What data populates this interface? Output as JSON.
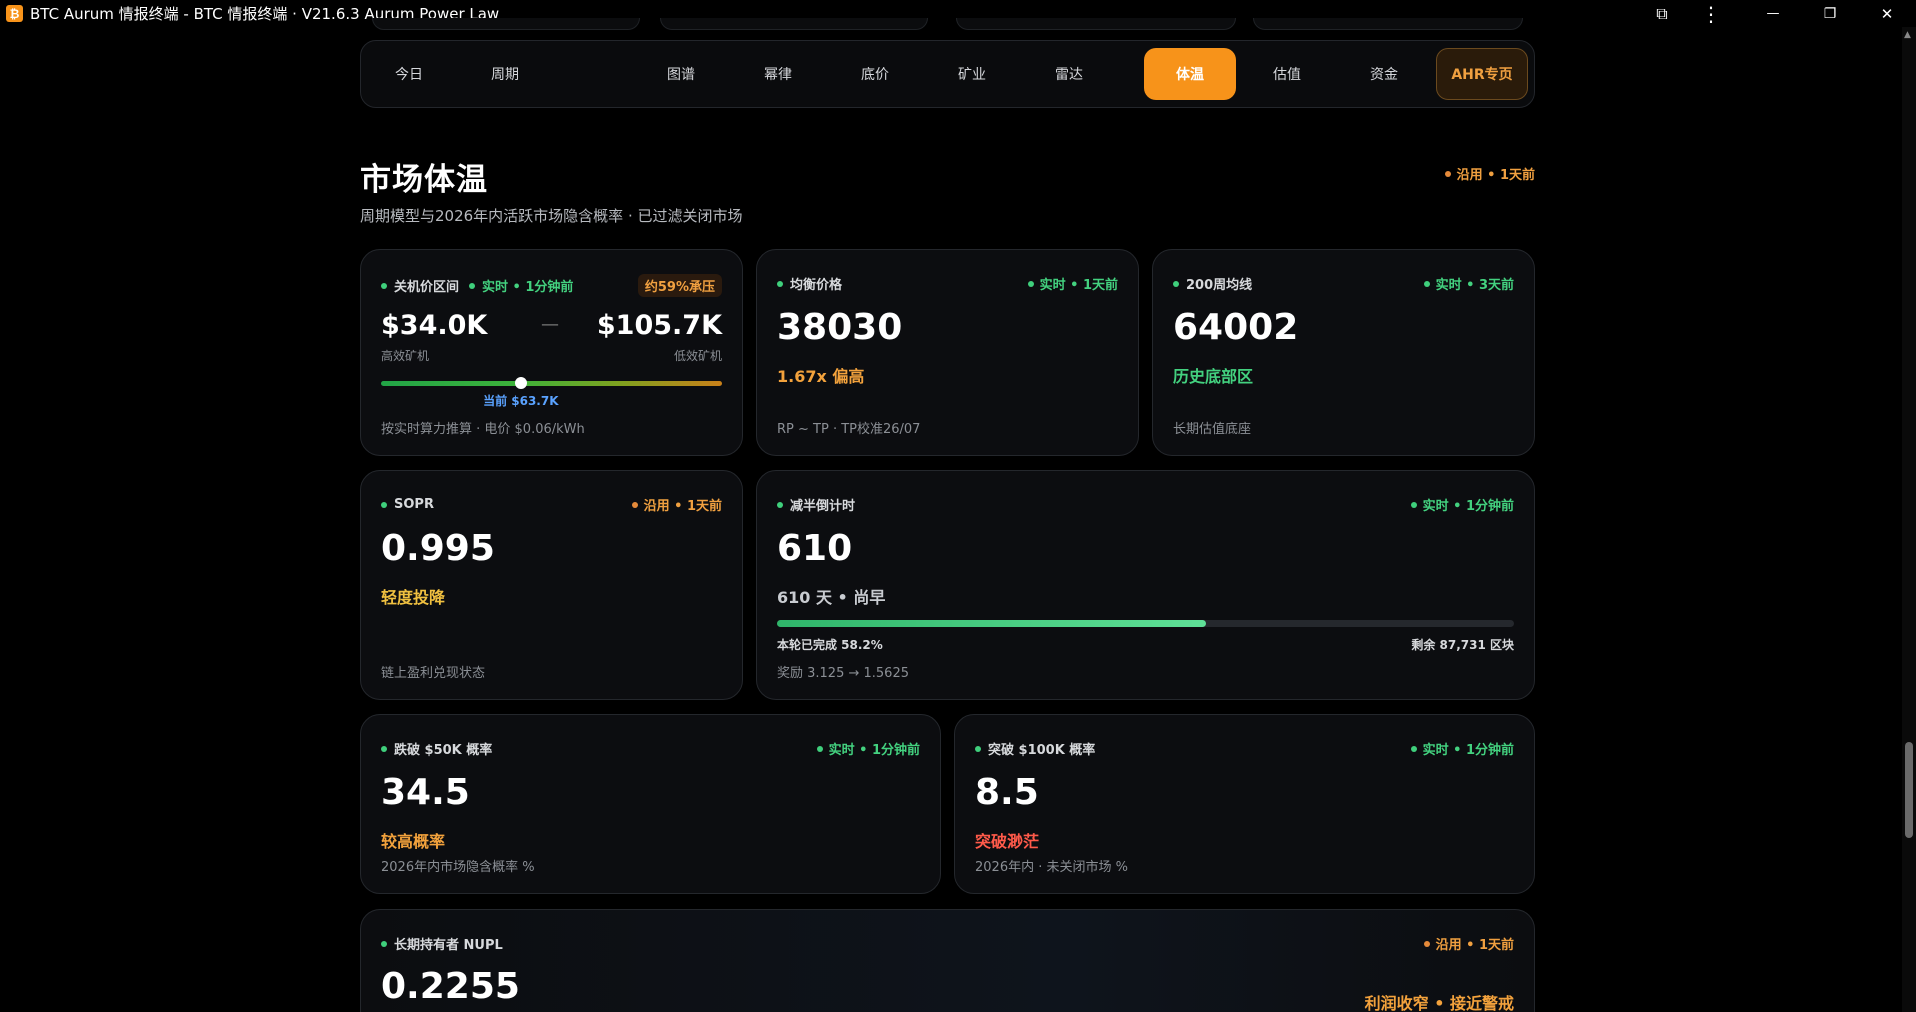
{
  "window": {
    "title": "BTC Aurum 情报终端 - BTC 情报终端 · V21.6.3 Aurum Power Law",
    "logo_glyph": "₿",
    "extension_glyph": "⧉",
    "menu_glyph": "⋮",
    "minimize_glyph": "—",
    "maximize_glyph": "❐",
    "close_glyph": "✕"
  },
  "nav": {
    "tabs": [
      "今日",
      "周期",
      "图谱",
      "幂律",
      "底价",
      "矿业",
      "雷达",
      "体温",
      "估值",
      "资金",
      "AHR专页"
    ],
    "active": "体温"
  },
  "section": {
    "title": "市场体温",
    "subtitle": "周期模型与2026年内活跃市场隐含概率 · 已过滤关闭市场",
    "status": "沿用 • 1天前"
  },
  "shutdown": {
    "label": "关机价区间",
    "status": "实时 • 1分钟前",
    "badge": "约59%承压",
    "low_value": "$34.0K",
    "low_caption": "高效矿机",
    "dash": "—",
    "high_value": "$105.7K",
    "high_caption": "低效矿机",
    "current_label": "当前 $63.7K",
    "position": 0.41,
    "footnote": "按实时算力推算 · 电价 $0.06/kWh"
  },
  "balance": {
    "label": "均衡价格",
    "status": "实时 • 1天前",
    "value": "38030",
    "tag": "1.67x 偏高",
    "footnote": "RP ~ TP · TP校准26/07"
  },
  "ma200w": {
    "label": "200周均线",
    "status": "实时 • 3天前",
    "value": "64002",
    "tag": "历史底部区",
    "footnote": "长期估值底座"
  },
  "sopr": {
    "label": "SOPR",
    "status": "沿用 • 1天前",
    "value": "0.995",
    "tag": "轻度投降",
    "footnote": "链上盈利兑现状态"
  },
  "halving": {
    "label": "减半倒计时",
    "status": "实时 • 1分钟前",
    "value": "610",
    "tag": "610 天 • 尚早",
    "progress": 0.582,
    "progress_label": "本轮已完成 58.2%",
    "remaining": "剩余 87,731 区块",
    "footnote": "奖励 3.125 → 1.5625"
  },
  "below50k": {
    "label": "跌破 $50K 概率",
    "status": "实时 • 1分钟前",
    "value": "34.5",
    "tag": "较高概率",
    "footnote": "2026年内市场隐含概率 %"
  },
  "above100k": {
    "label": "突破 $100K 概率",
    "status": "实时 • 1分钟前",
    "value": "8.5",
    "tag": "突破渺茫",
    "footnote": "2026年内 · 未关闭市场 %"
  },
  "nupl": {
    "label": "长期持有者 NUPL",
    "status": "沿用 • 1天前",
    "value": "0.2255",
    "tag": "利润收窄 • 接近警戒"
  }
}
